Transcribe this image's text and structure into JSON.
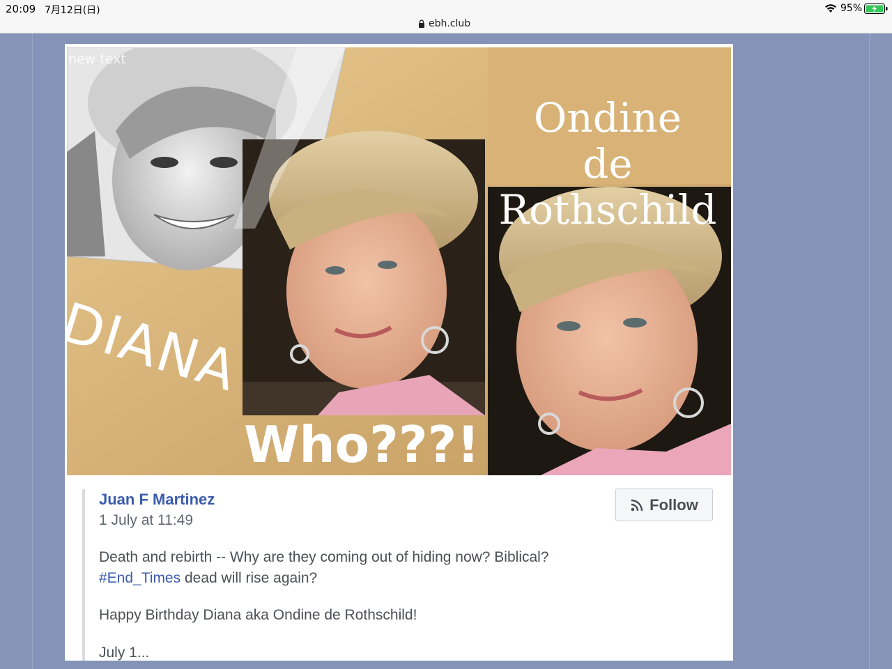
{
  "status_bar": {
    "time": "20:09",
    "date": "7月12日(日)",
    "battery_percent": "95%",
    "url": "ebh.club"
  },
  "image": {
    "overlay_small": "new text",
    "ondine_line1": "Ondine",
    "ondine_line2": "de Rothschild",
    "diana_label": "DIANA",
    "who_label": "Who???!"
  },
  "post": {
    "author": "Juan F Martinez",
    "timestamp": "1 July at 11:49",
    "follow_label": "Follow",
    "text_line1": "Death and rebirth -- Why are they coming out of hiding now? Biblical?",
    "hashtag": "#End_Times",
    "text_line2_rest": " dead will rise again?",
    "text_line3": "Happy Birthday Diana aka Ondine de Rothschild!",
    "text_line4": "July 1..."
  },
  "colors": {
    "page_background": "#8795b9",
    "link_blue": "#3b5bae",
    "gold_background": "#cfab72"
  }
}
